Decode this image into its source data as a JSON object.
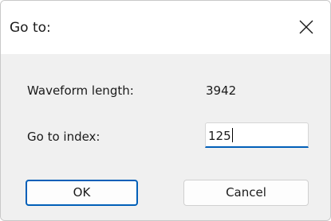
{
  "window": {
    "title": "Go to:",
    "close_icon": "close-icon"
  },
  "form": {
    "waveform_length_label": "Waveform length:",
    "waveform_length_value": "3942",
    "go_to_index_label": "Go to index:",
    "go_to_index_value": "125"
  },
  "buttons": {
    "ok_label": "OK",
    "cancel_label": "Cancel"
  },
  "colors": {
    "accent": "#005fb8",
    "body_background": "#f0f0f0",
    "title_background": "#ffffff"
  }
}
